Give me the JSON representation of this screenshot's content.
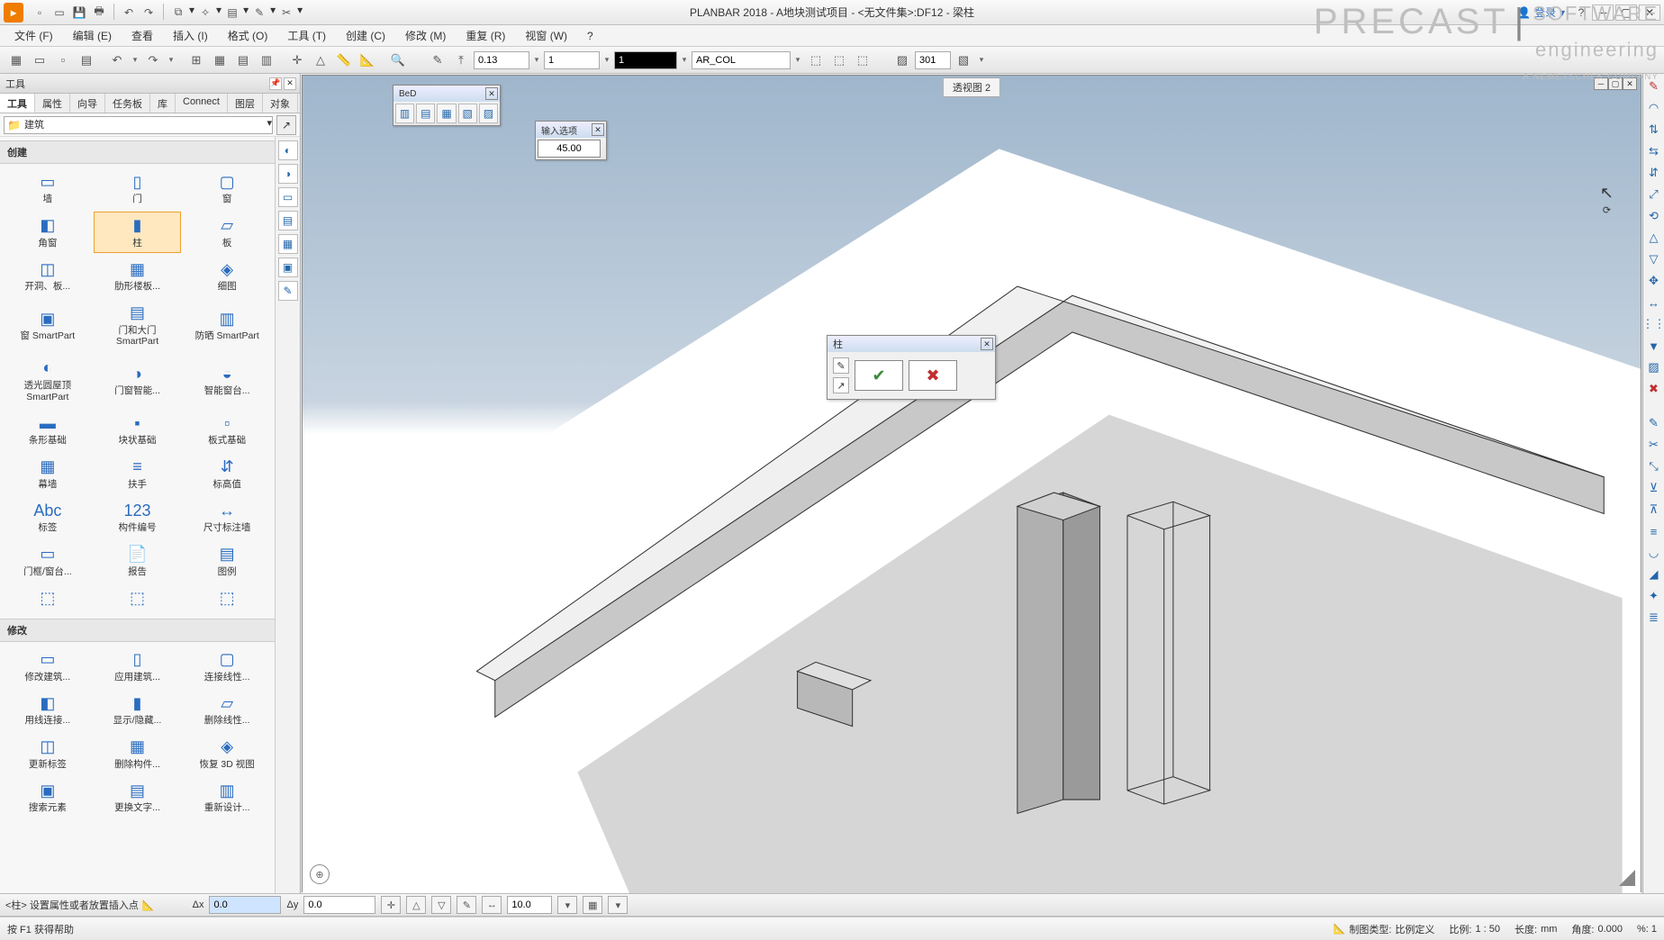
{
  "app": {
    "title": "PLANBAR 2018 - A地块测试项目 - <无文件集>:DF12 - 梁柱",
    "login": "登录"
  },
  "brand": {
    "main": "PRECAST",
    "sw1": "SOFTWARE",
    "sw2": "engineering",
    "sub": "A NEMETSCHEK COMPANY"
  },
  "menu": {
    "file": "文件 (F)",
    "edit": "编辑 (E)",
    "view": "查看",
    "insert": "插入 (I)",
    "format": "格式 (O)",
    "tools": "工具 (T)",
    "create": "创建 (C)",
    "modify": "修改 (M)",
    "repeat": "重复 (R)",
    "window": "视窗 (W)",
    "help": "?"
  },
  "toolbar": {
    "linewidth": "0.13",
    "linetype": "1",
    "color": "1",
    "layer": "AR_COL",
    "num": "301"
  },
  "leftpanel": {
    "title": "工具",
    "tabs": {
      "tools": "工具",
      "props": "属性",
      "nav": "向导",
      "task": "任务板",
      "lib": "库",
      "connect": "Connect",
      "layers": "图层",
      "objects": "对象"
    },
    "category": "建筑",
    "sections": {
      "create": "创建",
      "modify": "修改"
    },
    "create": [
      {
        "lbl": "墙"
      },
      {
        "lbl": "门"
      },
      {
        "lbl": "窗"
      },
      {
        "lbl": "角窗"
      },
      {
        "lbl": "柱",
        "active": true
      },
      {
        "lbl": "板"
      },
      {
        "lbl": "开洞、板..."
      },
      {
        "lbl": "肋形楼板..."
      },
      {
        "lbl": "细图"
      },
      {
        "lbl": "窗 SmartPart"
      },
      {
        "lbl": "门和大门 SmartPart"
      },
      {
        "lbl": "防晒 SmartPart"
      },
      {
        "lbl": "透光圆屋顶 SmartPart"
      },
      {
        "lbl": "门窗智能..."
      },
      {
        "lbl": "智能窗台..."
      },
      {
        "lbl": "条形基础"
      },
      {
        "lbl": "块状基础"
      },
      {
        "lbl": "板式基础"
      },
      {
        "lbl": "幕墙"
      },
      {
        "lbl": "扶手"
      },
      {
        "lbl": "标高值"
      },
      {
        "lbl": "标签"
      },
      {
        "lbl": "构件编号"
      },
      {
        "lbl": "尺寸标注墙"
      },
      {
        "lbl": "门框/窗台..."
      },
      {
        "lbl": "报告"
      },
      {
        "lbl": "图例"
      },
      {
        "lbl": ""
      },
      {
        "lbl": ""
      },
      {
        "lbl": ""
      }
    ],
    "modify": [
      {
        "lbl": "修改建筑..."
      },
      {
        "lbl": "应用建筑..."
      },
      {
        "lbl": "连接线性..."
      },
      {
        "lbl": "用线连接..."
      },
      {
        "lbl": "显示/隐藏..."
      },
      {
        "lbl": "删除线性..."
      },
      {
        "lbl": "更新标签"
      },
      {
        "lbl": "删除构件..."
      },
      {
        "lbl": "恢复 3D 视图"
      },
      {
        "lbl": "搜索元素"
      },
      {
        "lbl": "更换文字..."
      },
      {
        "lbl": "重新设计..."
      }
    ]
  },
  "viewport": {
    "label": "透视图 2"
  },
  "float": {
    "bed_title": "BeD",
    "input_title": "输入选项",
    "input_value": "45.00",
    "dlg_title": "柱"
  },
  "inputbar": {
    "prompt": "<柱>  设置属性或者放置插入点",
    "dx_label": "Δx",
    "dx": "0.0",
    "dy_label": "Δy",
    "dy": "0.0",
    "val": "10.0"
  },
  "status": {
    "help": "按 F1 获得帮助",
    "drawtype_lbl": "制图类型:",
    "drawtype_val": "比例定义",
    "scale_lbl": "比例:",
    "scale_val": "1 : 50",
    "len_lbl": "长度:",
    "len_val": "mm",
    "angle_lbl": "角度:",
    "angle_val": "0.000",
    "pct": "%: 1"
  }
}
